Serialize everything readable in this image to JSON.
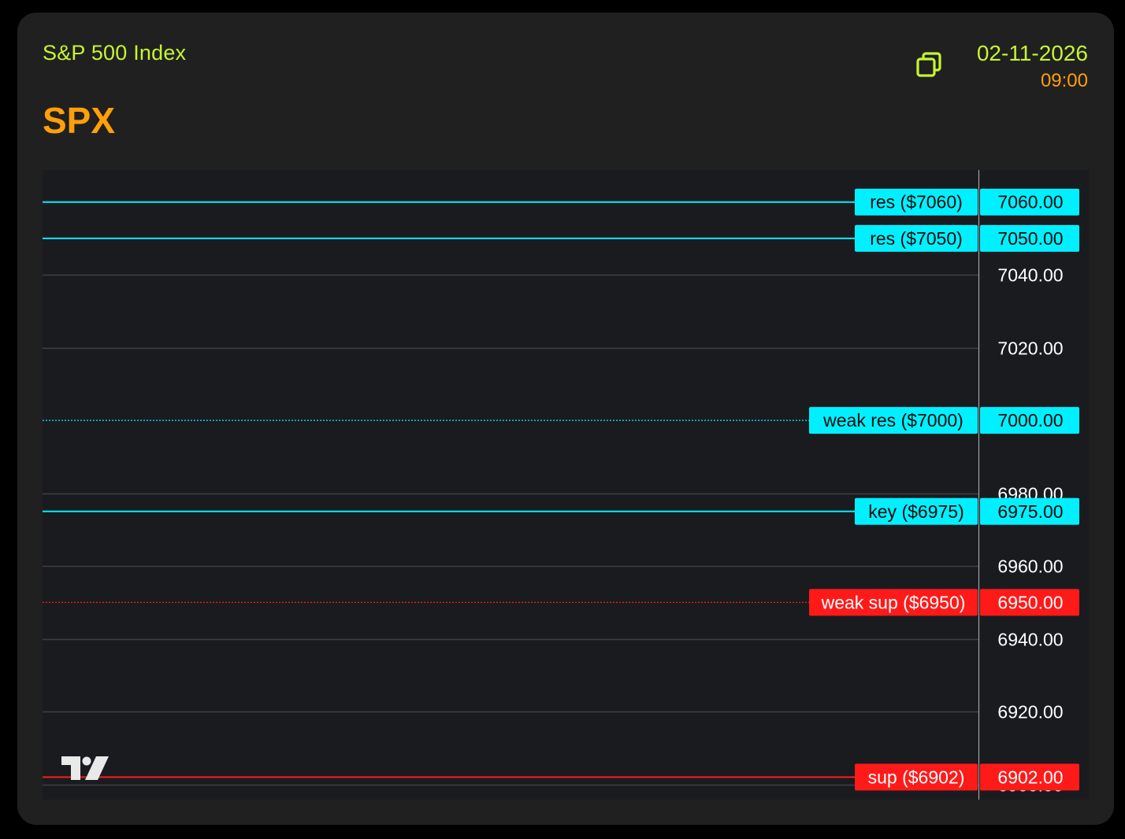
{
  "header": {
    "index_name": "S&P 500 Index",
    "ticker": "SPX",
    "date": "02-11-2026",
    "time": "09:00",
    "copy_icon": "copy-icon"
  },
  "colors": {
    "card_bg": "#202020",
    "chart_bg": "#1a1b1f",
    "accent_green": "#c6f432",
    "accent_orange": "#ff9f0a",
    "resistance": "#00f0ff",
    "support": "#ff1a1a",
    "grid": "#3e4046",
    "axis_text": "#ffffff"
  },
  "chart_data": {
    "type": "line",
    "title": "",
    "xlabel": "",
    "ylabel": "",
    "ylim": [
      6895.8,
      7068.8
    ],
    "grid": true,
    "y_ticks": [
      "7040.00",
      "7020.00",
      "6980.00",
      "6960.00",
      "6940.00",
      "6920.00",
      "6900.00"
    ],
    "levels": [
      {
        "label": "res ($7060)",
        "value": 7060,
        "value_label": "7060.00",
        "kind": "resistance",
        "style": "solid"
      },
      {
        "label": "res ($7050)",
        "value": 7050,
        "value_label": "7050.00",
        "kind": "resistance",
        "style": "solid"
      },
      {
        "label": "weak res ($7000)",
        "value": 7000,
        "value_label": "7000.00",
        "kind": "resistance",
        "style": "dotted"
      },
      {
        "label": "key ($6975)",
        "value": 6975,
        "value_label": "6975.00",
        "kind": "resistance",
        "style": "solid"
      },
      {
        "label": "weak sup ($6950)",
        "value": 6950,
        "value_label": "6950.00",
        "kind": "support",
        "style": "dotted"
      },
      {
        "label": "sup ($6902)",
        "value": 6902,
        "value_label": "6902.00",
        "kind": "support",
        "style": "solid"
      }
    ]
  },
  "watermark": {
    "icon": "tradingview-logo-icon"
  }
}
